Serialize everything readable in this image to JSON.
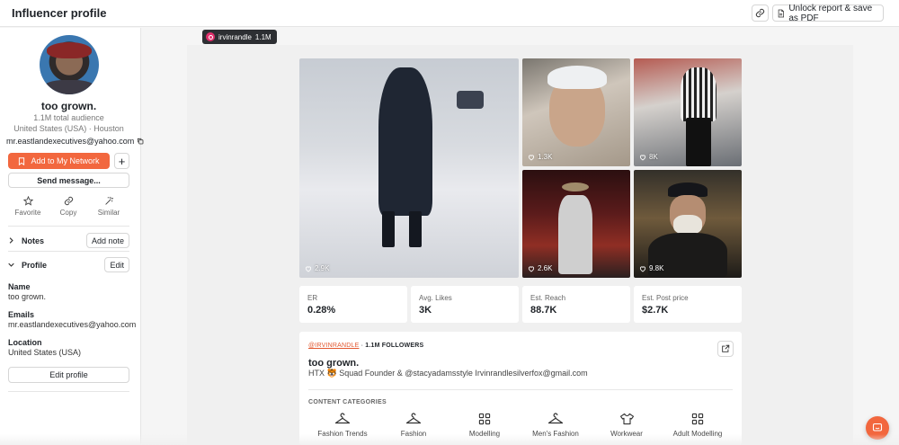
{
  "header": {
    "title": "Influencer profile",
    "unlock_label": "Unlock report & save as PDF"
  },
  "profile": {
    "name": "too grown.",
    "audience": "1.1M total audience",
    "location": "United States (USA) · Houston",
    "email": "mr.eastlandexecutives@yahoo.com"
  },
  "actions": {
    "add_network": "Add to My Network",
    "plus": "+",
    "send_message": "Send message...",
    "favorite": "Favorite",
    "copy": "Copy",
    "similar": "Similar"
  },
  "notes": {
    "label": "Notes",
    "button": "Add note"
  },
  "profile_section": {
    "label": "Profile",
    "button": "Edit",
    "name_label": "Name",
    "name_value": "too grown.",
    "emails_label": "Emails",
    "emails_value": "mr.eastlandexecutives@yahoo.com",
    "location_label": "Location",
    "location_value": "United States (USA)",
    "edit_profile": "Edit profile"
  },
  "account": {
    "handle": "irvinrandle",
    "followers": "1.1M"
  },
  "posts": [
    {
      "likes": "2.9K"
    },
    {
      "likes": "1.3K"
    },
    {
      "likes": "8K"
    },
    {
      "likes": "2.6K"
    },
    {
      "likes": "9.8K"
    }
  ],
  "stats": [
    {
      "label": "ER",
      "value": "0.28%"
    },
    {
      "label": "Avg. Likes",
      "value": "3K"
    },
    {
      "label": "Est. Reach",
      "value": "88.7K"
    },
    {
      "label": "Est. Post price",
      "value": "$2.7K"
    }
  ],
  "about": {
    "handle": "@IRVINRANDLE",
    "followers_text": "1.1M FOLLOWERS",
    "name": "too grown.",
    "bio": "HTX 🐯 Squad Founder & @stacyadamsstyle Irvinrandlesilverfox@gmail.com",
    "categories_title": "CONTENT CATEGORIES",
    "categories": [
      {
        "label": "Fashion Trends",
        "icon": "hanger-icon"
      },
      {
        "label": "Fashion",
        "icon": "hanger-icon"
      },
      {
        "label": "Modelling",
        "icon": "grid-icon"
      },
      {
        "label": "Men's Fashion",
        "icon": "hanger-icon"
      },
      {
        "label": "Workwear",
        "icon": "tshirt-icon"
      },
      {
        "label": "Adult Modelling",
        "icon": "grid-icon"
      }
    ]
  },
  "colors": {
    "accent": "#f2673e",
    "chip_bg": "#2d2f33",
    "instagram": "#e1306c"
  }
}
